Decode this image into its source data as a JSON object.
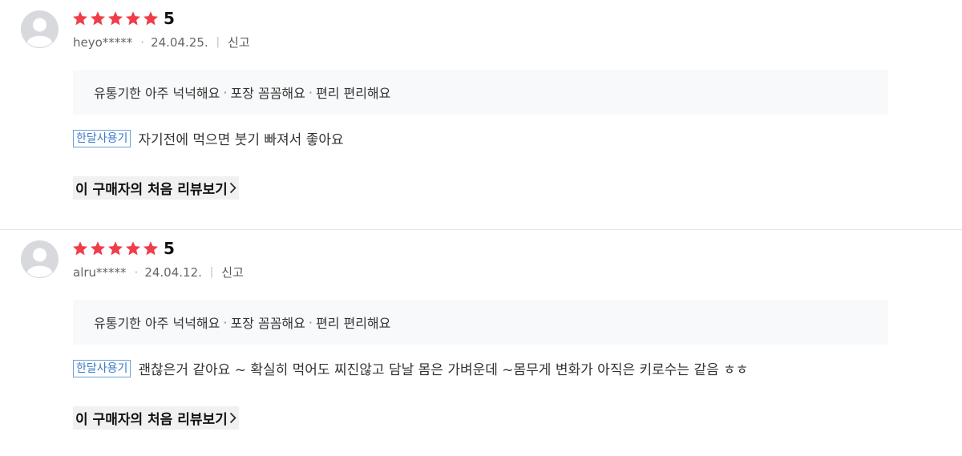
{
  "reviews": [
    {
      "rating": "5",
      "stars_filled": 5,
      "user": "heyo*****",
      "date": "24.04.25.",
      "report": "신고",
      "options": [
        "유통기한 아주 넉넉해요",
        "포장 꼼꼼해요",
        "편리 편리해요"
      ],
      "tag": "한달사용기",
      "text": "자기전에 먹으면 붓기 빠져서 좋아요",
      "first_review_link": "이 구매자의 처음 리뷰보기"
    },
    {
      "rating": "5",
      "stars_filled": 5,
      "user": "alru*****",
      "date": "24.04.12.",
      "report": "신고",
      "options": [
        "유통기한 아주 넉넉해요",
        "포장 꼼꼼해요",
        "편리 편리해요"
      ],
      "tag": "한달사용기",
      "text": "괜찮은거 같아요 ~ 확실히 먹어도 찌진않고 담날 몸은 가벼운데 ~몸무게 변화가 아직은 키로수는 같음 ㅎㅎ",
      "first_review_link": "이 구매자의 처음 리뷰보기"
    }
  ],
  "colors": {
    "star": "#f03d4a",
    "tag_border": "#6aa0d8",
    "tag_text": "#3a78c6",
    "option_bg": "#f8f9fa"
  }
}
